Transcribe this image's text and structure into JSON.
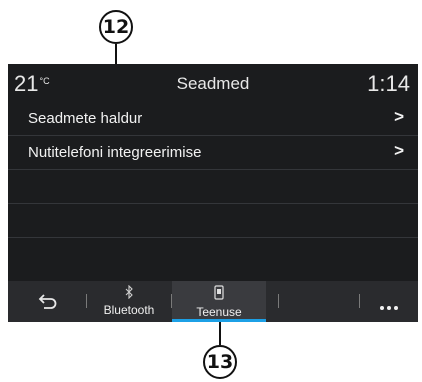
{
  "callouts": {
    "top": "12",
    "bottom": "13"
  },
  "status_bar": {
    "temperature": "21",
    "temperature_unit": "°C",
    "title": "Seadmed",
    "time": "1:14"
  },
  "menu": {
    "items": [
      {
        "label": "Seadmete haldur",
        "chevron": ">"
      },
      {
        "label": "Nutitelefoni integreerimise",
        "chevron": ">"
      },
      {
        "label": ""
      },
      {
        "label": ""
      },
      {
        "label": ""
      }
    ]
  },
  "bottom_bar": {
    "back_icon": "back-arrow-icon",
    "bluetooth": {
      "icon": "bluetooth-icon",
      "label": "Bluetooth"
    },
    "services": {
      "icon": "phone-services-icon",
      "label": "Teenuse"
    },
    "more_icon": "more-dots-icon",
    "accent_color": "#1ca0e6"
  }
}
